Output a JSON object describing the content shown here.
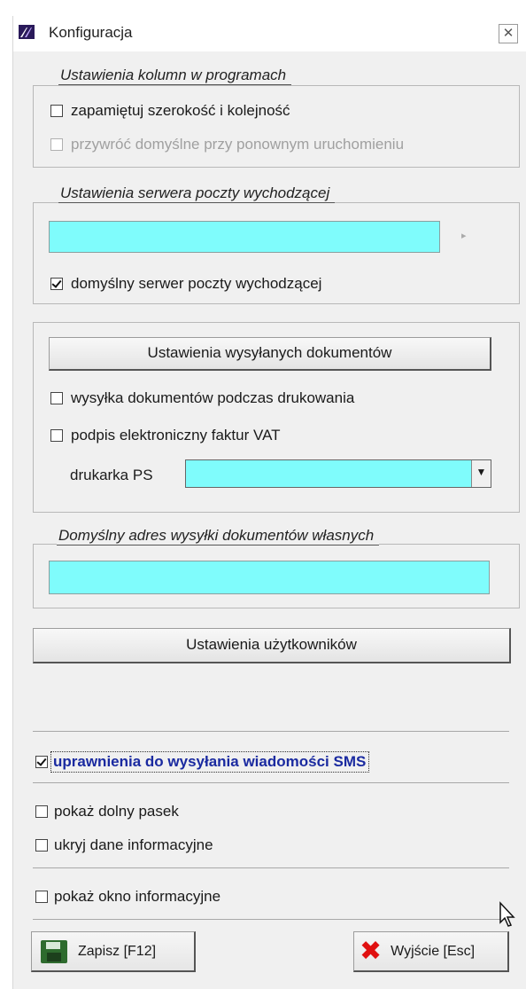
{
  "window": {
    "title": "Konfiguracja",
    "close_symbol": "✕"
  },
  "columns_group": {
    "legend": "Ustawienia kolumn w programach",
    "remember_label": "zapamiętuj szerokość i kolejność",
    "remember_checked": false,
    "restore_label": "przywróć domyślne przy ponownym uruchomieniu",
    "restore_checked": false,
    "restore_disabled": true
  },
  "mail_group": {
    "legend": "Ustawienia serwera poczty wychodzącej",
    "server_value": "",
    "arrow_symbol": "▸",
    "default_label": "domyślny serwer poczty wychodzącej",
    "default_checked": true
  },
  "documents_group": {
    "settings_button": "Ustawienia wysyłanych dokumentów",
    "print_send_label": "wysyłka dokumentów podczas drukowania",
    "print_send_checked": false,
    "signature_label": "podpis elektroniczny faktur VAT",
    "signature_checked": false,
    "printer_label": "drukarka PS",
    "printer_value": "",
    "dropdown_symbol": "▼"
  },
  "address_group": {
    "legend": "Domyślny adres wysyłki dokumentów własnych",
    "address_value": ""
  },
  "users_button": "Ustawienia użytkowników",
  "sms": {
    "label": "uprawnienia do wysyłania wiadomości SMS",
    "checked": true
  },
  "options": {
    "bottom_bar_label": "pokaż dolny pasek",
    "hide_info_label": "ukryj dane informacyjne",
    "info_window_label": "pokaż okno informacyjne"
  },
  "footer": {
    "save_label": "Zapisz  [F12]",
    "exit_label": "Wyjście  [Esc]",
    "exit_symbol": "✖"
  },
  "colors": {
    "field_cyan": "#7ffcfc",
    "sms_blue": "#1a2aa0",
    "exit_red": "#e01010"
  }
}
